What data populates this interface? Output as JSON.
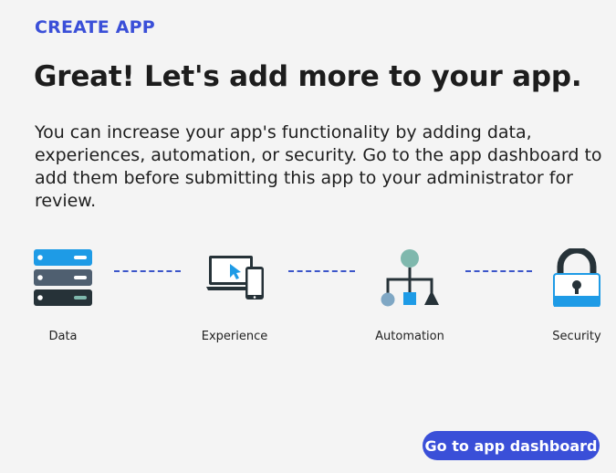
{
  "header": {
    "eyebrow": "CREATE APP",
    "title": "Great! Let's add more to your app.",
    "description": "You can increase your app's functionality by adding data, experiences, automation, or security. Go to the app dashboard to add them before submitting this app to your administrator for review."
  },
  "steps": [
    {
      "label": "Data",
      "icon": "database-icon"
    },
    {
      "label": "Experience",
      "icon": "devices-icon"
    },
    {
      "label": "Automation",
      "icon": "flow-icon"
    },
    {
      "label": "Security",
      "icon": "lock-icon"
    }
  ],
  "colors": {
    "accent": "#3a4fd8",
    "icon_blue": "#1e9be6",
    "icon_dark": "#263238",
    "icon_slate": "#4f5f70",
    "icon_teal": "#7fb8ad"
  },
  "actions": {
    "primary_label": "Go to app dashboard"
  }
}
